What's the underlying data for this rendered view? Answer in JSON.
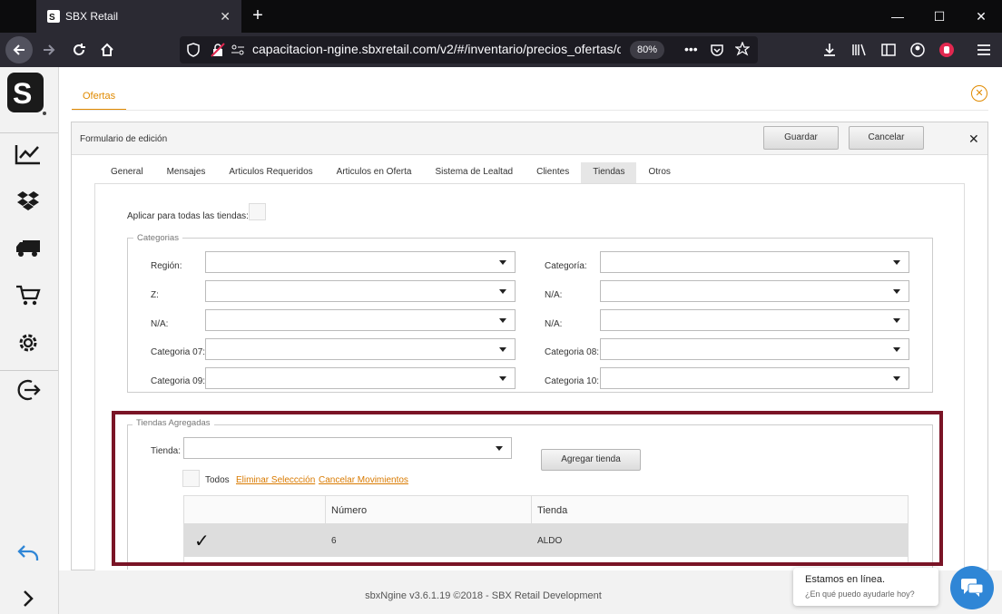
{
  "browser": {
    "tab_title": "SBX Retail",
    "url": "capacitacion-ngine.sbxretail.com/v2/#/inventario/precios_ofertas/o",
    "zoom": "80%"
  },
  "page": {
    "tab_label": "Ofertas"
  },
  "panel": {
    "title": "Formulario de edición",
    "save_label": "Guardar",
    "cancel_label": "Cancelar",
    "tabs": [
      {
        "label": "General"
      },
      {
        "label": "Mensajes"
      },
      {
        "label": "Articulos Requeridos"
      },
      {
        "label": "Articulos en Oferta"
      },
      {
        "label": "Sistema de Lealtad"
      },
      {
        "label": "Clientes"
      },
      {
        "label": "Tiendas"
      },
      {
        "label": "Otros"
      }
    ],
    "active_tab": "Tiendas"
  },
  "tiendas_form": {
    "apply_all_label": "Aplicar para todas las tiendas:",
    "categorias_legend": "Categorias",
    "fields": [
      {
        "label": "Región:"
      },
      {
        "label": "Categoría:"
      },
      {
        "label": "Z:"
      },
      {
        "label": "N/A:"
      },
      {
        "label": "N/A:"
      },
      {
        "label": "N/A:"
      },
      {
        "label": "Categoria 07:"
      },
      {
        "label": "Categoria 08:"
      },
      {
        "label": "Categoria 09:"
      },
      {
        "label": "Categoria 10:"
      }
    ],
    "agregadas_legend": "Tiendas Agregadas",
    "tienda_label": "Tienda:",
    "add_button": "Agregar tienda",
    "todos_label": "Todos",
    "eliminar_link": "Eliminar Seleccción",
    "cancelar_link": "Cancelar Movimientos",
    "grid": {
      "columns": [
        "",
        "Número",
        "Tienda"
      ],
      "rows": [
        {
          "checked": "✓",
          "numero": "6",
          "tienda": "ALDO"
        }
      ]
    }
  },
  "footer": {
    "text": "sbxNgine v3.6.1.19 ©2018 - SBX Retail Development"
  },
  "chat": {
    "title": "Estamos en línea.",
    "subtitle": "¿En qué puedo ayudarle hoy?"
  },
  "colors": {
    "accent": "#e08a00",
    "highlight": "#7a1426",
    "chat": "#2f86d6"
  }
}
